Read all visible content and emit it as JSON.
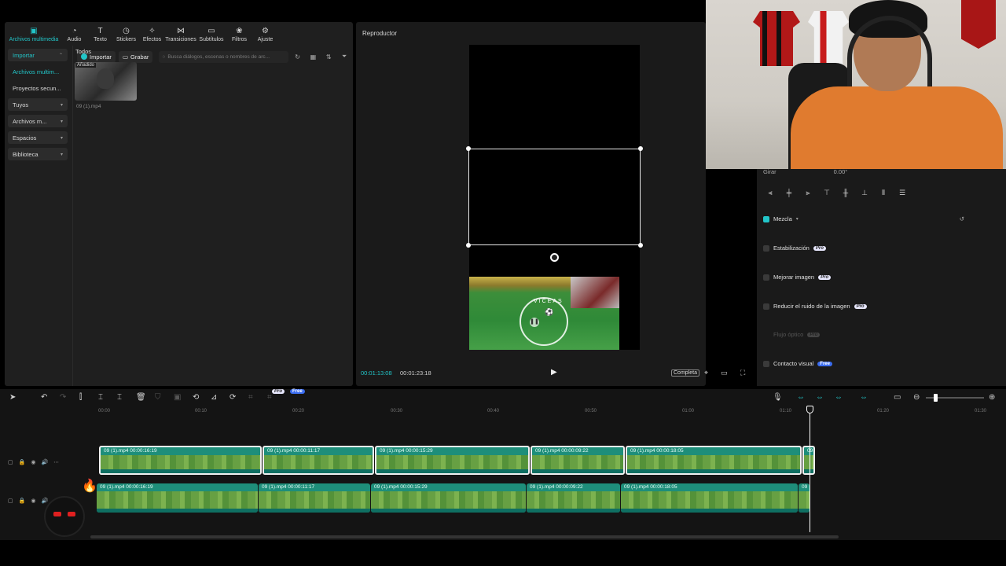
{
  "toolbar": {
    "tabs": [
      {
        "label": "Archivos multimedia",
        "icon": "media-icon"
      },
      {
        "label": "Audio",
        "icon": "audio-icon"
      },
      {
        "label": "Texto",
        "icon": "text-icon"
      },
      {
        "label": "Stickers",
        "icon": "sticker-icon"
      },
      {
        "label": "Efectos",
        "icon": "effects-icon"
      },
      {
        "label": "Transiciones",
        "icon": "transitions-icon"
      },
      {
        "label": "Subtítulos",
        "icon": "subtitles-icon"
      },
      {
        "label": "Filtros",
        "icon": "filters-icon"
      },
      {
        "label": "Ajuste",
        "icon": "adjust-icon"
      }
    ]
  },
  "sidebar": {
    "items": [
      {
        "label": "Importar"
      },
      {
        "label": "Archivos multim..."
      },
      {
        "label": "Proyectos secun..."
      },
      {
        "label": "Tuyos"
      },
      {
        "label": "Archivos m..."
      },
      {
        "label": "Espacios"
      },
      {
        "label": "Biblioteca"
      }
    ]
  },
  "media": {
    "import_label": "Importar",
    "record_label": "Grabar",
    "search_placeholder": "Busca diálogos, escenas o nombres de arc...",
    "filter_label": "Todos",
    "thumb_tag": "Añadido",
    "thumb_name": "09 (1).mp4"
  },
  "player": {
    "title": "Reproductor",
    "current_time": "00:01:13:08",
    "total_time": "00:01:23:18",
    "ratio_label": "Completa",
    "overlay_text": "VICEAS"
  },
  "properties": {
    "rotate_label": "Girar",
    "rotate_value": "0.00°",
    "blend_label": "Mezcla",
    "stabilize_label": "Estabilización",
    "enhance_label": "Mejorar imagen",
    "denoise_label": "Reducir el ruido de la imagen",
    "optical_flow_label": "Flujo óptico",
    "eye_contact_label": "Contacto visual",
    "pro_badge": "Pro",
    "free_badge": "Free"
  },
  "timeline": {
    "ruler": [
      "00:00",
      "00:10",
      "00:20",
      "00:30",
      "00:40",
      "00:50",
      "01:00",
      "01:10",
      "01:20",
      "01:30"
    ],
    "track1_clips": [
      {
        "label": "09 (1).mp4   00:00:16:19"
      },
      {
        "label": "09 (1).mp4   00:00:11:17"
      },
      {
        "label": "09 (1).mp4   00:00:15:29"
      },
      {
        "label": "09 (1).mp4   00:00:09:22"
      },
      {
        "label": "09 (1).mp4   00:00:18:05"
      },
      {
        "label": "09"
      }
    ],
    "track2_clips": [
      {
        "label": "09 (1).mp4   00:00:16:19"
      },
      {
        "label": "09 (1).mp4   00:00:11:17"
      },
      {
        "label": "09 (1).mp4   00:00:15:29"
      },
      {
        "label": "09 (1).mp4   00:00:09:22"
      },
      {
        "label": "09 (1).mp4   00:00:18:05"
      },
      {
        "label": "09"
      }
    ],
    "pro_badge": "Pro",
    "free_badge": "Free"
  },
  "colors": {
    "accent": "#22c5c8",
    "clip": "#1e8e7a",
    "panel": "#1f1f1f"
  }
}
